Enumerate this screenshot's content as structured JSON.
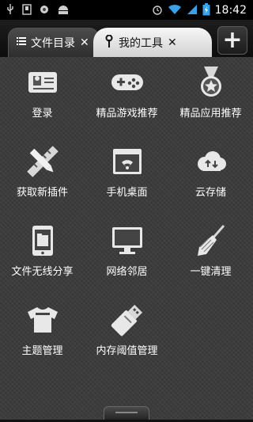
{
  "statusbar": {
    "time": "18:42",
    "left_icons": [
      "usb-icon",
      "sdcard-icon",
      "record-icon",
      "android-icon"
    ],
    "right_icons": [
      "alarm-icon",
      "wifi-icon",
      "signal-icon",
      "battery-icon"
    ]
  },
  "tabs": [
    {
      "label": "文件目录",
      "icon": "list-icon",
      "active": false
    },
    {
      "label": "我的工具",
      "icon": "wrench-icon",
      "active": true
    }
  ],
  "tab_close_glyph": "✕",
  "add_button_glyph": "+",
  "tools": [
    {
      "label": "登录",
      "icon": "id-card-icon"
    },
    {
      "label": "精品游戏推荐",
      "icon": "gamepad-icon"
    },
    {
      "label": "精品应用推荐",
      "icon": "medal-icon"
    },
    {
      "label": "获取新插件",
      "icon": "pencil-ruler-icon"
    },
    {
      "label": "手机桌面",
      "icon": "wifi-window-icon"
    },
    {
      "label": "云存储",
      "icon": "cloud-icon"
    },
    {
      "label": "文件无线分享",
      "icon": "phone-file-icon"
    },
    {
      "label": "网络邻居",
      "icon": "monitor-icon"
    },
    {
      "label": "一键清理",
      "icon": "broom-icon"
    },
    {
      "label": "主题管理",
      "icon": "tshirt-icon"
    },
    {
      "label": "内存阈值管理",
      "icon": "usb-drive-icon"
    }
  ]
}
